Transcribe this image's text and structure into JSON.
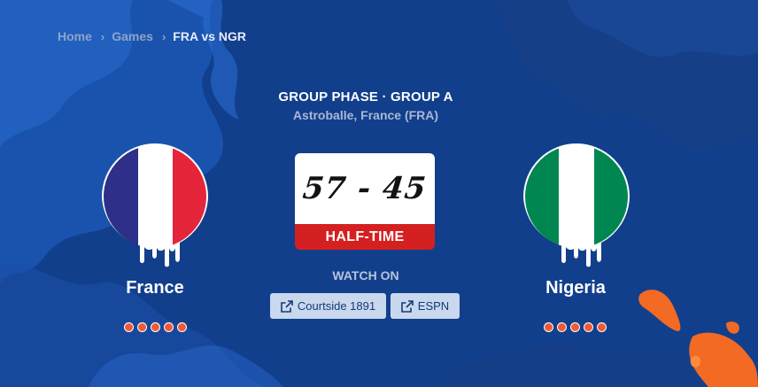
{
  "breadcrumb": {
    "items": [
      "Home",
      "Games",
      "FRA vs NGR"
    ]
  },
  "match": {
    "phase": "GROUP PHASE · GROUP A",
    "venue": "Astroballe, France (FRA)",
    "score": "57 - 45",
    "status": "HALF-TIME"
  },
  "home": {
    "name": "France",
    "flag_colors": [
      "#2d2f88",
      "#ffffff",
      "#e4253a"
    ],
    "dots": 5
  },
  "away": {
    "name": "Nigeria",
    "flag_colors": [
      "#008751",
      "#ffffff",
      "#008751"
    ],
    "dots": 5
  },
  "watch": {
    "label": "WATCH ON",
    "providers": [
      "Courtside 1891",
      "ESPN"
    ],
    "icon": "external-link-icon"
  },
  "colors": {
    "background": "#123f8c",
    "accent": "#ef5a38",
    "status_bar": "#d42020",
    "button_bg": "#c9d8ec"
  }
}
